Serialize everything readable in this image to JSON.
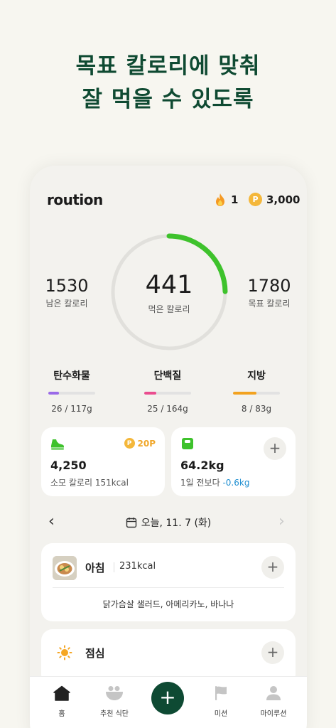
{
  "headline": {
    "line1": "목표 칼로리에 맞춰",
    "line2": "잘 먹을 수 있도록"
  },
  "app": {
    "logo": "roution",
    "streak": "1",
    "points_symbol": "P",
    "points": "3,000"
  },
  "calories": {
    "remaining": "1530",
    "remaining_label": "남은 칼로리",
    "consumed": "441",
    "consumed_label": "먹은 칼로리",
    "goal": "1780",
    "goal_label": "목표 칼로리",
    "ring_progress": 0.248
  },
  "macros": [
    {
      "name": "탄수화물",
      "value": "26 / 117g",
      "progress": 0.22,
      "color": "#9a6ae8"
    },
    {
      "name": "단백질",
      "value": "25 / 164g",
      "progress": 0.25,
      "color": "#ea4d8f"
    },
    {
      "name": "지방",
      "value": "8 / 83g",
      "progress": 0.5,
      "color": "#f2a21f"
    }
  ],
  "steps": {
    "count": "4,250",
    "calorie_text": "소모 칼로리 151kcal",
    "reward": "20P",
    "icon": "sneaker-icon"
  },
  "weight": {
    "value": "64.2kg",
    "compare_label": "1일 전보다",
    "delta": "-0.6kg",
    "icon": "scale-icon"
  },
  "date_nav": {
    "label": "오늘, 11. 7 (화)",
    "prev": "‹",
    "next": "›"
  },
  "meals": {
    "breakfast": {
      "name": "아침",
      "kcal": "231kcal",
      "foods": "닭가슴살 샐러드, 아메리카노, 바나나"
    },
    "lunch": {
      "name": "점심"
    }
  },
  "plus_symbol": "+",
  "tabs": [
    {
      "label": "홈",
      "icon": "home-icon"
    },
    {
      "label": "추천 식단",
      "icon": "bowl-icon"
    },
    {
      "label": "미션",
      "icon": "flag-icon"
    },
    {
      "label": "마이루션",
      "icon": "user-icon"
    }
  ],
  "colors": {
    "brand_dark": "#0e4a33",
    "ring_green": "#3ec22c",
    "point_yellow": "#f4b73a",
    "delta_blue": "#1f8fd1"
  }
}
